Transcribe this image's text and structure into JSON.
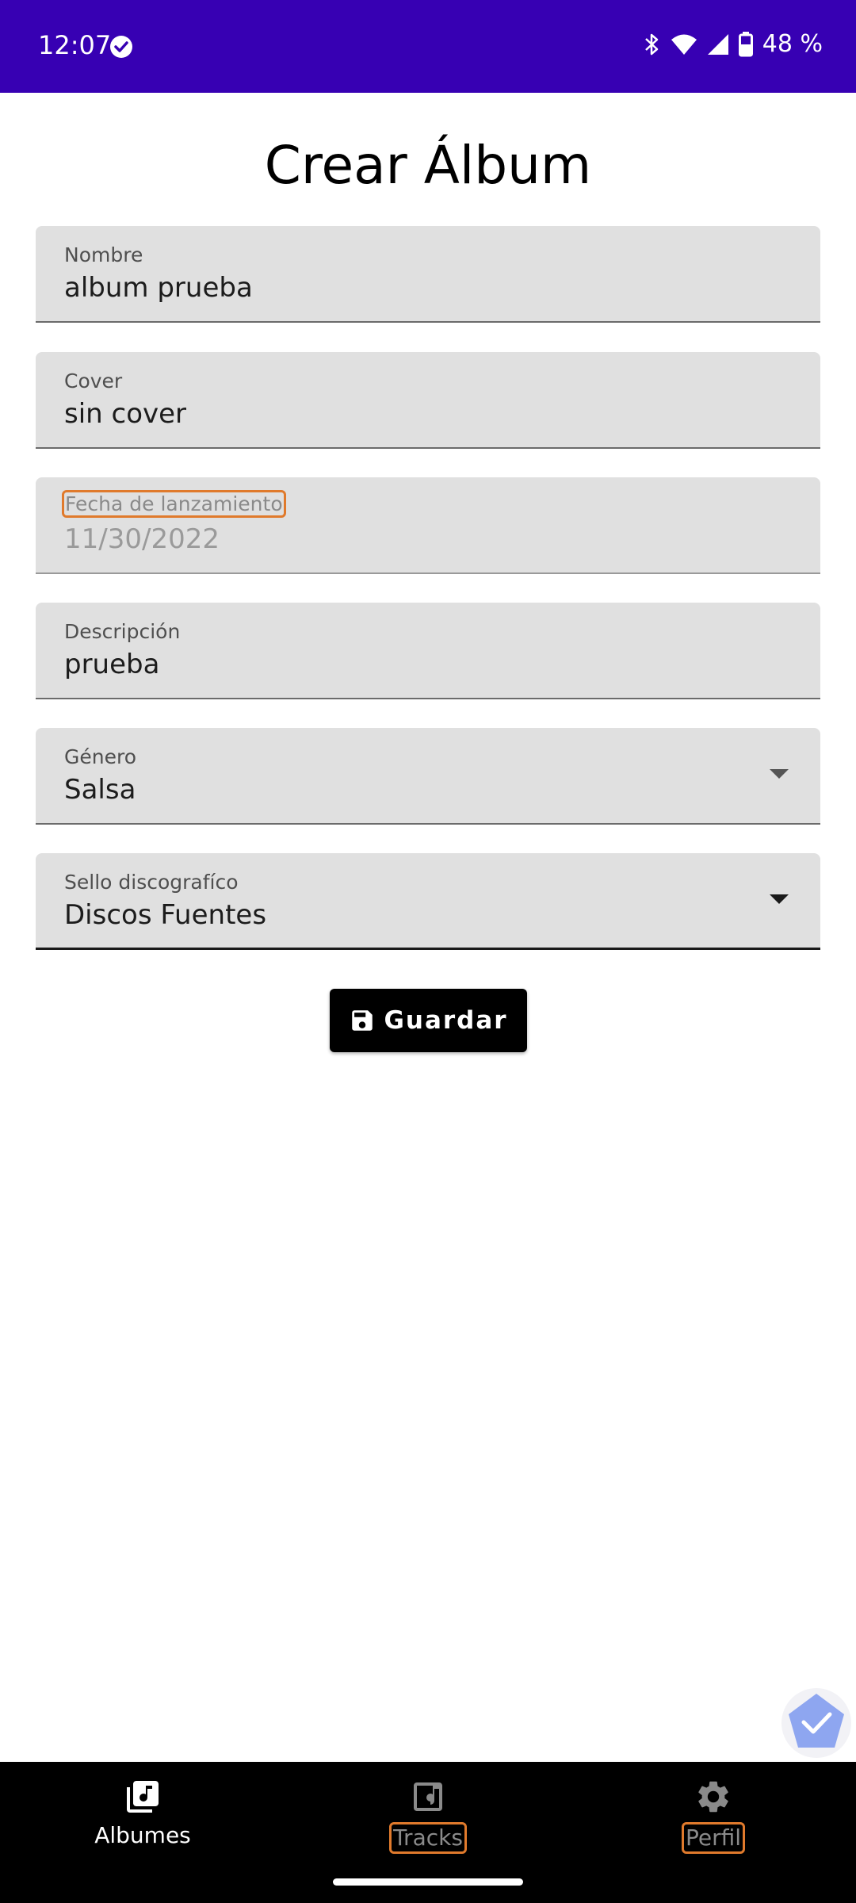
{
  "status_bar": {
    "time": "12:07",
    "battery": "48 %"
  },
  "page": {
    "title": "Crear Álbum"
  },
  "form": {
    "nombre": {
      "label": "Nombre",
      "value": "album prueba"
    },
    "cover": {
      "label": "Cover",
      "value": "sin cover"
    },
    "fecha": {
      "label": "Fecha de lanzamiento",
      "value": "11/30/2022"
    },
    "descripcion": {
      "label": "Descripción",
      "value": "prueba"
    },
    "genero": {
      "label": "Género",
      "value": "Salsa"
    },
    "sello": {
      "label": "Sello discografíco",
      "value": "Discos Fuentes"
    }
  },
  "actions": {
    "save_label": "Guardar"
  },
  "nav": {
    "albumes": "Albumes",
    "tracks": "Tracks",
    "perfil": "Perfil"
  },
  "colors": {
    "status_bar": "#3700b3",
    "field_bg": "#e0e0e0",
    "highlight": "#e07a2c",
    "nav_bg": "#000000"
  }
}
